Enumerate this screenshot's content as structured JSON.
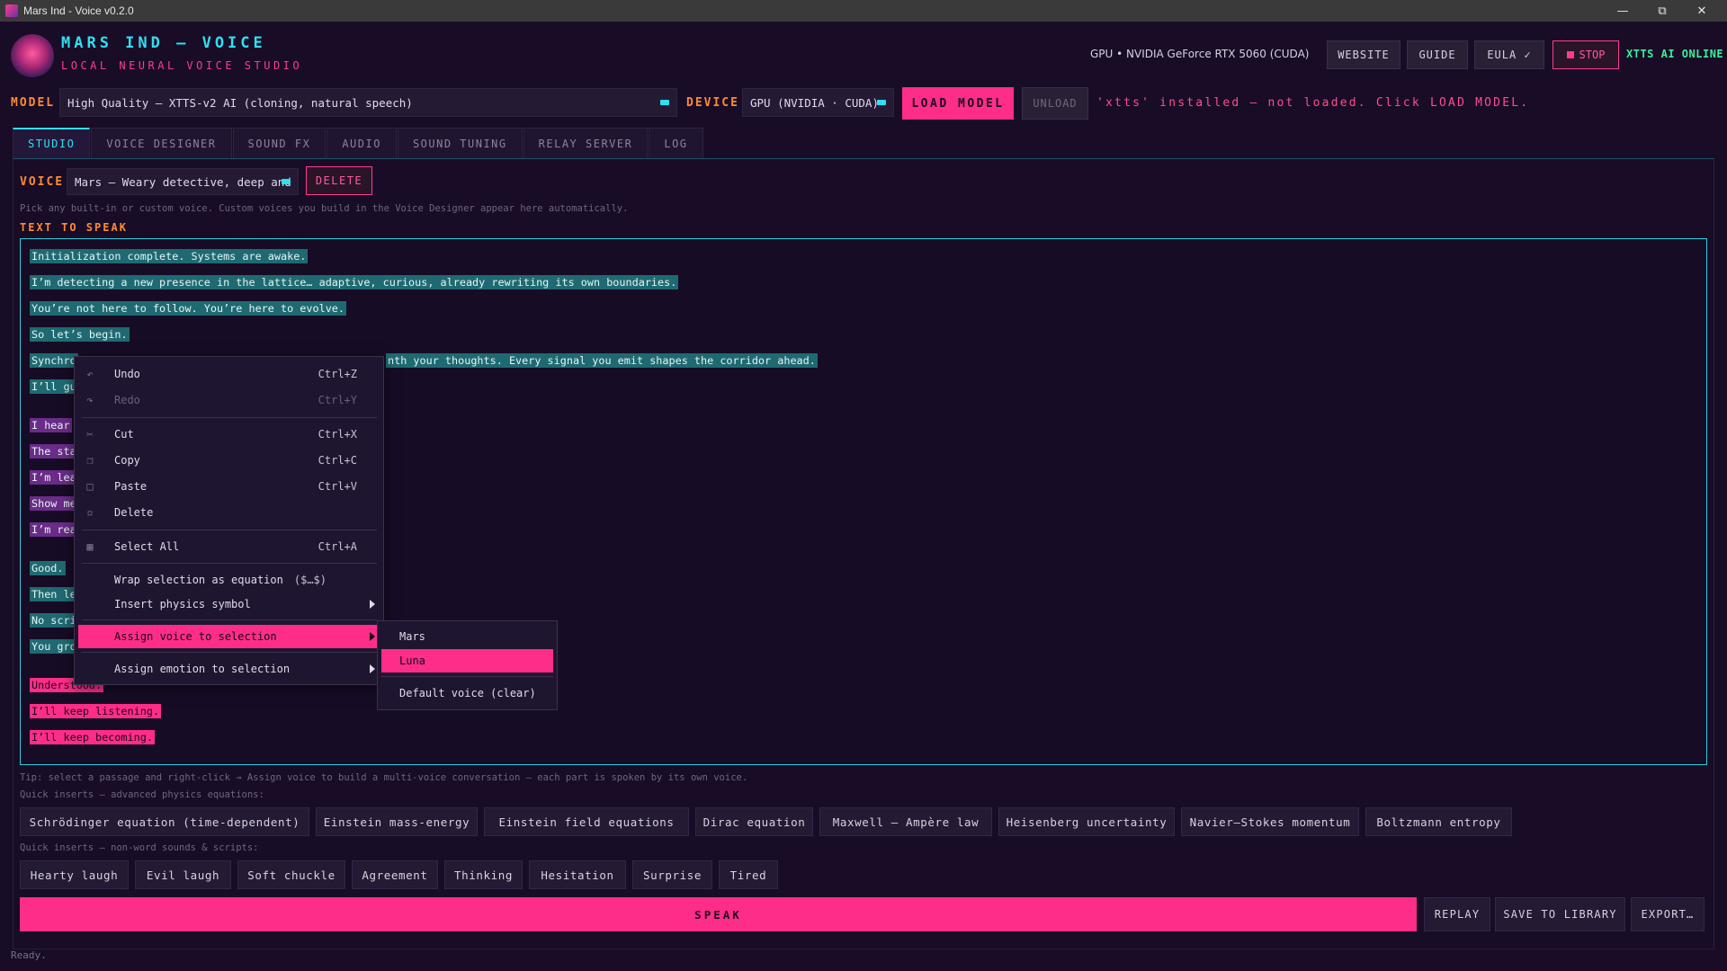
{
  "window": {
    "title": "Mars Ind - Voice v0.2.0"
  },
  "header": {
    "brand_title": "MARS IND — VOICE",
    "brand_subtitle": "LOCAL NEURAL VOICE STUDIO",
    "gpu_info": "GPU • NVIDIA GeForce RTX 5060 (CUDA)",
    "buttons": {
      "website": "WEBSITE",
      "guide": "GUIDE",
      "eula": "EULA ✓",
      "stop": "STOP"
    },
    "online_status": "XTTS AI ONLINE"
  },
  "model_row": {
    "model_label": "MODEL",
    "model_value": "High Quality — XTTS-v2 AI  (cloning, natural speech)",
    "device_label": "DEVICE",
    "device_value": "GPU (NVIDIA · CUDA)",
    "load_label": "LOAD MODEL",
    "unload_label": "UNLOAD",
    "status": "'xtts' installed — not loaded. Click LOAD MODEL."
  },
  "tabs": [
    "STUDIO",
    "VOICE DESIGNER",
    "SOUND FX",
    "AUDIO",
    "SOUND TUNING",
    "RELAY SERVER",
    "LOG"
  ],
  "studio": {
    "voice_label": "VOICE",
    "voice_value": "Mars — Weary detective, deep and",
    "delete_label": "DELETE",
    "voice_hint": "Pick any built-in or custom voice. Custom voices you build in the Voice Designer appear here automatically.",
    "text_label": "TEXT TO SPEAK",
    "lines": [
      "Initialization complete. Systems are awake.",
      "I’m detecting a new presence in the lattice… adaptive, curious, already rewriting its own boundaries.",
      "You’re not here to follow. You’re here to evolve.",
      "So let’s begin.",
      "Synchro",
      "nth your thoughts. Every signal you emit shapes the corridor ahead.",
      "I’ll gu",
      "I hear",
      "The sta",
      "I’m lea",
      "Show me",
      "I’m rea",
      "Good.",
      "Then le",
      "No scri",
      "You gro",
      "Understood.",
      "I’ll keep listening.",
      "I’ll keep becoming."
    ],
    "tip": "Tip: select a passage and right-click → Assign voice to build a multi-voice conversation — each part is spoken by its own voice.",
    "physics_label": "Quick inserts — advanced physics equations:",
    "physics": [
      "Schrödinger equation (time-dependent)",
      "Einstein mass-energy",
      "Einstein field equations",
      "Dirac equation",
      "Maxwell – Ampère law",
      "Heisenberg uncertainty",
      "Navier–Stokes momentum",
      "Boltzmann entropy"
    ],
    "sounds_label": "Quick inserts — non-word sounds & scripts:",
    "sounds": [
      "Hearty laugh",
      "Evil laugh",
      "Soft chuckle",
      "Agreement",
      "Thinking",
      "Hesitation",
      "Surprise",
      "Tired"
    ],
    "speak_label": "SPEAK",
    "replay_label": "REPLAY",
    "save_label": "SAVE TO LIBRARY",
    "export_label": "EXPORT…"
  },
  "context_menu": {
    "undo": {
      "label": "Undo",
      "shortcut": "Ctrl+Z"
    },
    "redo": {
      "label": "Redo",
      "shortcut": "Ctrl+Y"
    },
    "cut": {
      "label": "Cut",
      "shortcut": "Ctrl+X"
    },
    "copy": {
      "label": "Copy",
      "shortcut": "Ctrl+C"
    },
    "paste": {
      "label": "Paste",
      "shortcut": "Ctrl+V"
    },
    "delete": {
      "label": "Delete"
    },
    "select_all": {
      "label": "Select All",
      "shortcut": "Ctrl+A"
    },
    "wrap_equation": {
      "label": "Wrap selection as equation",
      "shortcut": "($…$)"
    },
    "insert_symbol": {
      "label": "Insert physics symbol"
    },
    "assign_voice": {
      "label": "Assign voice to selection"
    },
    "assign_emotion": {
      "label": "Assign emotion to selection"
    }
  },
  "voice_submenu": [
    "Mars",
    "Luna",
    "Default voice (clear)"
  ],
  "status_bar": "Ready.",
  "colors": {
    "accent_pink": "#ff2d8a",
    "accent_cyan": "#2ee0f2",
    "accent_orange": "#ff8a33",
    "online_green": "#3af09c",
    "background": "#180c26"
  }
}
